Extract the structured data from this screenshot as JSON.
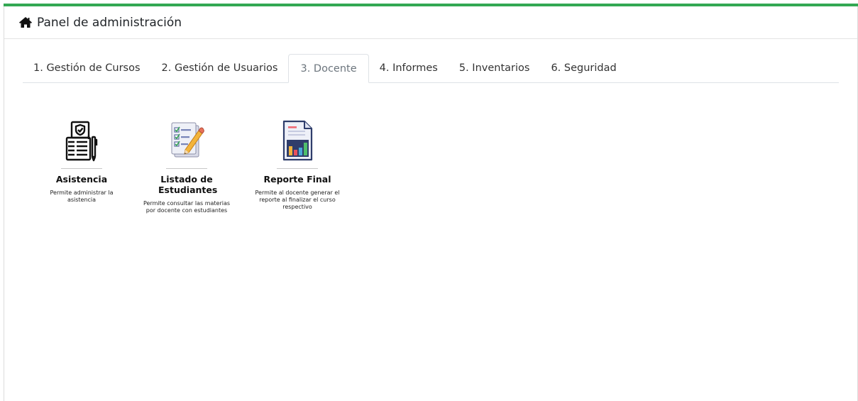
{
  "header": {
    "title": "Panel de administración",
    "icon": "home-icon"
  },
  "tabs": [
    {
      "label": "1. Gestión de Cursos",
      "active": false
    },
    {
      "label": "2. Gestión de Usuarios",
      "active": false
    },
    {
      "label": "3. Docente",
      "active": true
    },
    {
      "label": "4. Informes",
      "active": false
    },
    {
      "label": "5. Inventarios",
      "active": false
    },
    {
      "label": "6. Seguridad",
      "active": false
    }
  ],
  "modules": [
    {
      "title": "Asistencia",
      "description": "Permite administrar la asistencia",
      "icon": "attendance-clipboard-icon"
    },
    {
      "title": "Listado de Estudiantes",
      "description": "Permite consultar las materias por docente con estudiantes",
      "icon": "student-checklist-icon"
    },
    {
      "title": "Reporte Final",
      "description": "Permite al docente generar el reporte al finalizar el curso respectivo",
      "icon": "report-chart-icon"
    }
  ],
  "colors": {
    "accent_bar": "#33a853",
    "active_tab_text": "#6c757d"
  }
}
